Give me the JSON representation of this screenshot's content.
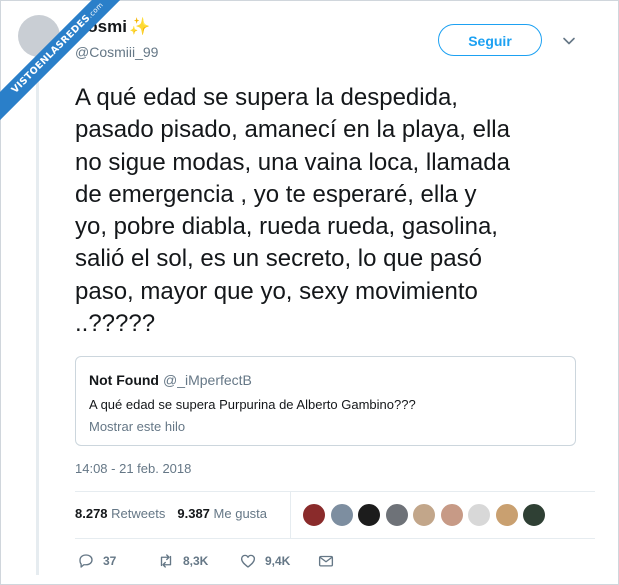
{
  "watermark": {
    "main": "VISTOENLASREDES",
    "suffix": ".com"
  },
  "user": {
    "name": "Cosmi",
    "badge": "✨",
    "handle": "@Cosmiii_99"
  },
  "follow_label": "Seguir",
  "tweet": {
    "text": "A qué edad se supera la despedida,\npasado pisado, amanecí en la playa, ella\nno sigue modas, una vaina loca, llamada\nde emergencia , yo te esperaré, ella y\nyo, pobre diabla, rueda rueda, gasolina,\nsalió el sol, es un secreto, lo que pasó\npaso, mayor que yo, sexy movimiento\n..?????"
  },
  "quoted": {
    "name": "Not Found",
    "handle": "@_iMperfectB",
    "text": "A qué edad se supera Purpurina de Alberto Gambino???",
    "link": "Mostrar este hilo"
  },
  "timestamp": "14:08 - 21 feb. 2018",
  "stats": {
    "retweets_count": "8.278",
    "retweets_label": "Retweets",
    "likes_count": "9.387",
    "likes_label": "Me gusta"
  },
  "likers": [
    {
      "color": "#8a2b2b"
    },
    {
      "color": "#7d8ea0"
    },
    {
      "color": "#1c1c1c"
    },
    {
      "color": "#6e7278"
    },
    {
      "color": "#c2a68a"
    },
    {
      "color": "#c79a86"
    },
    {
      "color": "#d8d8d8"
    },
    {
      "color": "#c9a070"
    },
    {
      "color": "#2f4034"
    }
  ],
  "actions": {
    "replies": "37",
    "retweets": "8,3K",
    "likes": "9,4K"
  },
  "icons": {
    "reply": "reply-icon",
    "retweet": "retweet-icon",
    "like": "heart-icon",
    "message": "envelope-icon",
    "more": "chevron-down-icon"
  },
  "colors": {
    "accent": "#1da1f2",
    "secondary": "#657786",
    "watermark": "#2a7fc9"
  }
}
